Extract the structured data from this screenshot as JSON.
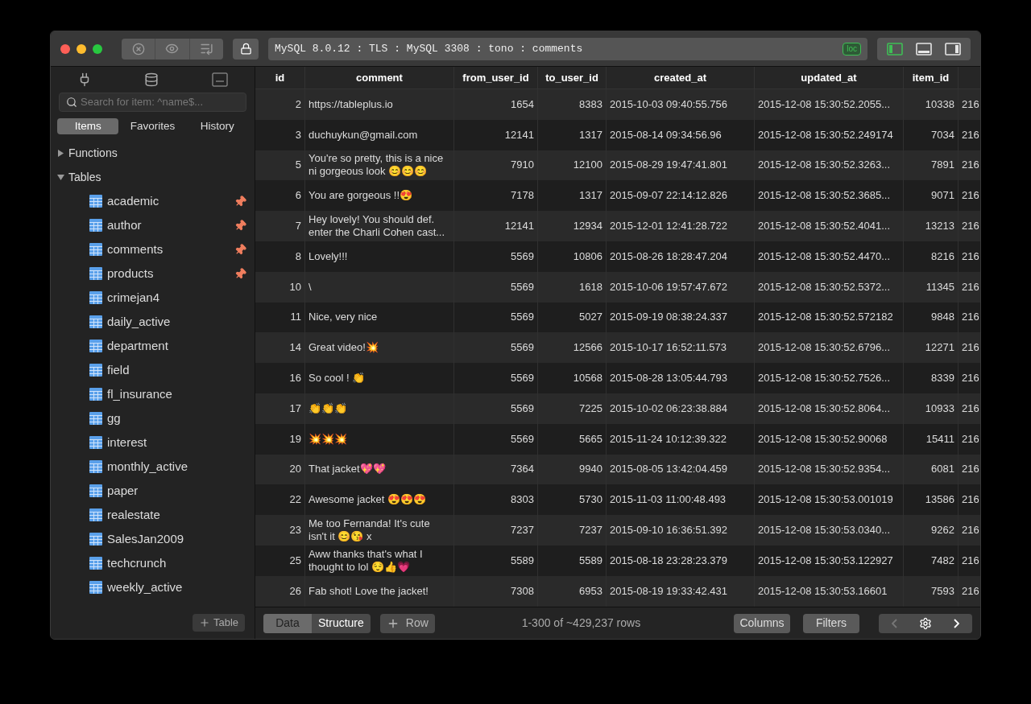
{
  "title_bar": {
    "address": "MySQL 8.0.12 : TLS : MySQL 3308 : tono : comments",
    "badge": "loc",
    "layout_toggles": [
      {
        "selected": true
      },
      {
        "selected": false
      },
      {
        "selected": false
      }
    ]
  },
  "sidebar": {
    "search": {
      "placeholder": "Search for item: ^name$..."
    },
    "tabs": [
      {
        "label": "Items",
        "selected": true
      },
      {
        "label": "Favorites",
        "selected": false
      },
      {
        "label": "History",
        "selected": false
      }
    ],
    "sections": [
      {
        "label": "Functions",
        "expanded": false
      },
      {
        "label": "Tables",
        "expanded": true,
        "children": [
          {
            "label": "academic",
            "pinned": true
          },
          {
            "label": "author",
            "pinned": true
          },
          {
            "label": "comments",
            "pinned": true
          },
          {
            "label": "products",
            "pinned": true
          },
          {
            "label": "crimejan4",
            "pinned": false
          },
          {
            "label": "daily_active",
            "pinned": false
          },
          {
            "label": "department",
            "pinned": false
          },
          {
            "label": "field",
            "pinned": false
          },
          {
            "label": "fl_insurance",
            "pinned": false
          },
          {
            "label": "gg",
            "pinned": false
          },
          {
            "label": "interest",
            "pinned": false
          },
          {
            "label": "monthly_active",
            "pinned": false
          },
          {
            "label": "paper",
            "pinned": false
          },
          {
            "label": "realestate",
            "pinned": false
          },
          {
            "label": "SalesJan2009",
            "pinned": false
          },
          {
            "label": "techcrunch",
            "pinned": false
          },
          {
            "label": "weekly_active",
            "pinned": false
          }
        ]
      }
    ],
    "add_button": "Table"
  },
  "table": {
    "columns": [
      "id",
      "comment",
      "from_user_id",
      "to_user_id",
      "created_at",
      "updated_at",
      "item_id"
    ],
    "rows": [
      [
        "2",
        "https://tableplus.io",
        "1654",
        "8383",
        "2015-10-03 09:40:55.756",
        "2015-12-08 15:30:52.2055...",
        "10338",
        "216"
      ],
      [
        "3",
        "duchuykun@gmail.com",
        "12141",
        "1317",
        "2015-08-14 09:34:56.96",
        "2015-12-08 15:30:52.249174",
        "7034",
        "216"
      ],
      [
        "5",
        "You're so pretty, this is a nice ni gorgeous look 😊😊😊",
        "7910",
        "12100",
        "2015-08-29 19:47:41.801",
        "2015-12-08 15:30:52.3263...",
        "7891",
        "216"
      ],
      [
        "6",
        "You are gorgeous !!😍",
        "7178",
        "1317",
        "2015-09-07 22:14:12.826",
        "2015-12-08 15:30:52.3685...",
        "9071",
        "216"
      ],
      [
        "7",
        "Hey lovely! You should def. enter the Charli Cohen cast...",
        "12141",
        "12934",
        "2015-12-01 12:41:28.722",
        "2015-12-08 15:30:52.4041...",
        "13213",
        "216"
      ],
      [
        "8",
        "Lovely!!!",
        "5569",
        "10806",
        "2015-08-26 18:28:47.204",
        "2015-12-08 15:30:52.4470...",
        "8216",
        "216"
      ],
      [
        "10",
        "\\",
        "5569",
        "1618",
        "2015-10-06 19:57:47.672",
        "2015-12-08 15:30:52.5372...",
        "11345",
        "216"
      ],
      [
        "11",
        "Nice, very nice",
        "5569",
        "5027",
        "2015-09-19 08:38:24.337",
        "2015-12-08 15:30:52.572182",
        "9848",
        "216"
      ],
      [
        "14",
        "Great video!💥",
        "5569",
        "12566",
        "2015-10-17 16:52:11.573",
        "2015-12-08 15:30:52.6796...",
        "12271",
        "216"
      ],
      [
        "16",
        "So cool ! 👏",
        "5569",
        "10568",
        "2015-08-28 13:05:44.793",
        "2015-12-08 15:30:52.7526...",
        "8339",
        "216"
      ],
      [
        "17",
        "👏👏👏",
        "5569",
        "7225",
        "2015-10-02 06:23:38.884",
        "2015-12-08 15:30:52.8064...",
        "10933",
        "216"
      ],
      [
        "19",
        "💥💥💥",
        "5569",
        "5665",
        "2015-11-24 10:12:39.322",
        "2015-12-08 15:30:52.90068",
        "15411",
        "216"
      ],
      [
        "20",
        "That jacket💖💖",
        "7364",
        "9940",
        "2015-08-05 13:42:04.459",
        "2015-12-08 15:30:52.9354...",
        "6081",
        "216"
      ],
      [
        "22",
        "Awesome jacket 😍😍😍",
        "8303",
        "5730",
        "2015-11-03 11:00:48.493",
        "2015-12-08 15:30:53.001019",
        "13586",
        "216"
      ],
      [
        "23",
        "Me too Fernanda! It's cute isn't it 😊😘 x",
        "7237",
        "7237",
        "2015-09-10 16:36:51.392",
        "2015-12-08 15:30:53.0340...",
        "9262",
        "216"
      ],
      [
        "25",
        "Aww thanks that's what I thought to lol 😌👍💗",
        "5589",
        "5589",
        "2015-08-18 23:28:23.379",
        "2015-12-08 15:30:53.122927",
        "7482",
        "216"
      ],
      [
        "26",
        "Fab shot! Love the jacket!",
        "7308",
        "6953",
        "2015-08-19 19:33:42.431",
        "2015-12-08 15:30:53.16601",
        "7593",
        "216"
      ]
    ]
  },
  "bottom_bar": {
    "view_tabs": [
      {
        "label": "Data",
        "selected": true
      },
      {
        "label": "Structure",
        "selected": false
      }
    ],
    "add_row": "Row",
    "status": "1-300 of ~429,237 rows",
    "buttons": [
      "Columns",
      "Filters"
    ],
    "previous": {
      "disabled": true
    },
    "next": {
      "disabled": false
    }
  }
}
